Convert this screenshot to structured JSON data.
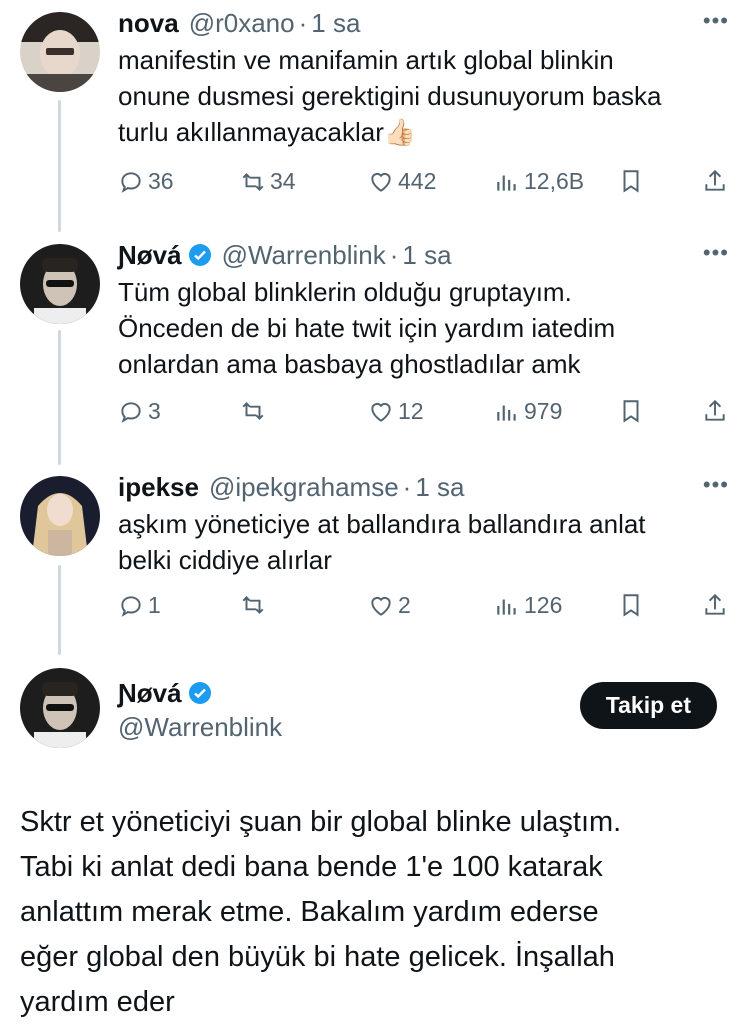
{
  "tweets": [
    {
      "name": "nova",
      "handle": "@r0xano",
      "time": "1 sa",
      "text_lines": [
        "manifestin ve manifamin artık global blinkin",
        "onune dusmesi gerektigini dusunuyorum baska",
        "turlu akıllanmayacaklar"
      ],
      "emoji": "👍🏻",
      "replies": "36",
      "retweets": "34",
      "likes": "442",
      "views": "12,6B",
      "verified": false
    },
    {
      "name": "Ɲøvá",
      "handle": "@Warrenblink",
      "time": "1 sa",
      "text_lines": [
        "Tüm global blinklerin olduğu gruptayım.",
        "Önceden de bi hate twit için yardım iatedim",
        "onlardan ama basbaya ghostladılar amk"
      ],
      "replies": "3",
      "retweets": "",
      "likes": "12",
      "views": "979",
      "verified": true
    },
    {
      "name": "ipekse",
      "handle": "@ipekgrahamse",
      "time": "1 sa",
      "text_lines": [
        "aşkım yöneticiye at ballandıra ballandıra anlat",
        "belki ciddiye alırlar"
      ],
      "replies": "1",
      "retweets": "",
      "likes": "2",
      "views": "126",
      "verified": false
    }
  ],
  "main_tweet": {
    "name": "Ɲøvá",
    "handle": "@Warrenblink",
    "follow_label": "Takip et",
    "text_lines": [
      "Sktr et yöneticiyi şuan bir global blinke ulaştım.",
      "Tabi ki anlat dedi bana bende 1'e 100 katarak",
      "anlattım merak etme. Bakalım yardım ederse",
      "eğer global den büyük bi hate gelicek. İnşallah",
      "yardım eder"
    ]
  },
  "ui": {
    "more_glyph": "•••",
    "dot": "·"
  },
  "colors": {
    "verified": "#1d9bf0",
    "muted": "#536471",
    "thread_line": "#cfd9de",
    "button_bg": "#0f1419"
  },
  "icons": [
    "reply-icon",
    "retweet-icon",
    "like-icon",
    "views-icon",
    "bookmark-icon",
    "share-icon",
    "verified-badge-icon",
    "more-icon"
  ]
}
